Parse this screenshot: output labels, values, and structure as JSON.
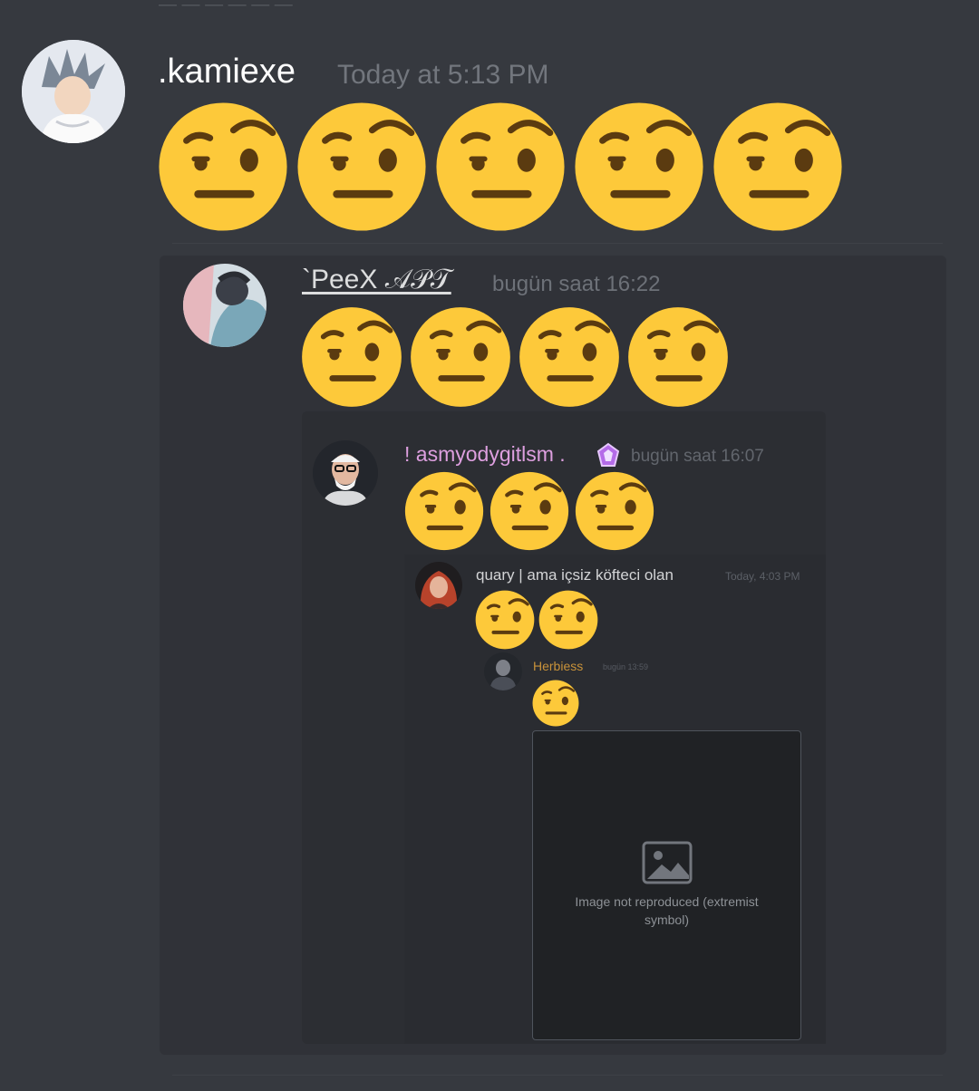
{
  "colors": {
    "background": "#36393f",
    "panel": "#303238",
    "timestamp": "#72767d",
    "emoji_face": "#fdc93a",
    "emoji_feature": "#5b3b10",
    "role_pink": "#dd9fdf",
    "role_gold": "#c8923a"
  },
  "messages": [
    {
      "author": ".kamiexe",
      "timestamp": "Today at 5:13 PM",
      "emoji": "face-with-raised-eyebrow",
      "emoji_count": 5
    },
    {
      "author": "`PeeX 𝒜𝒫𝒯",
      "timestamp": "bugün saat 16:22",
      "emoji": "face-with-raised-eyebrow",
      "emoji_count": 4
    },
    {
      "author": "! asmyodygitlsm .",
      "badge_icon": "crystal-badge-icon",
      "timestamp": "bugün saat 16:07",
      "emoji": "face-with-raised-eyebrow",
      "emoji_count": 3
    },
    {
      "author": "quary | ama içsiz köfteci olan",
      "timestamp": "Today, 4:03 PM",
      "emoji": "face-with-raised-eyebrow",
      "emoji_count": 2
    },
    {
      "author": "Herbiess",
      "timestamp": "bugün 13:59",
      "emoji": "face-with-raised-eyebrow",
      "emoji_count": 1,
      "attachment": {
        "kind": "photo",
        "note": "Image not reproduced (extremist symbol)"
      }
    }
  ]
}
